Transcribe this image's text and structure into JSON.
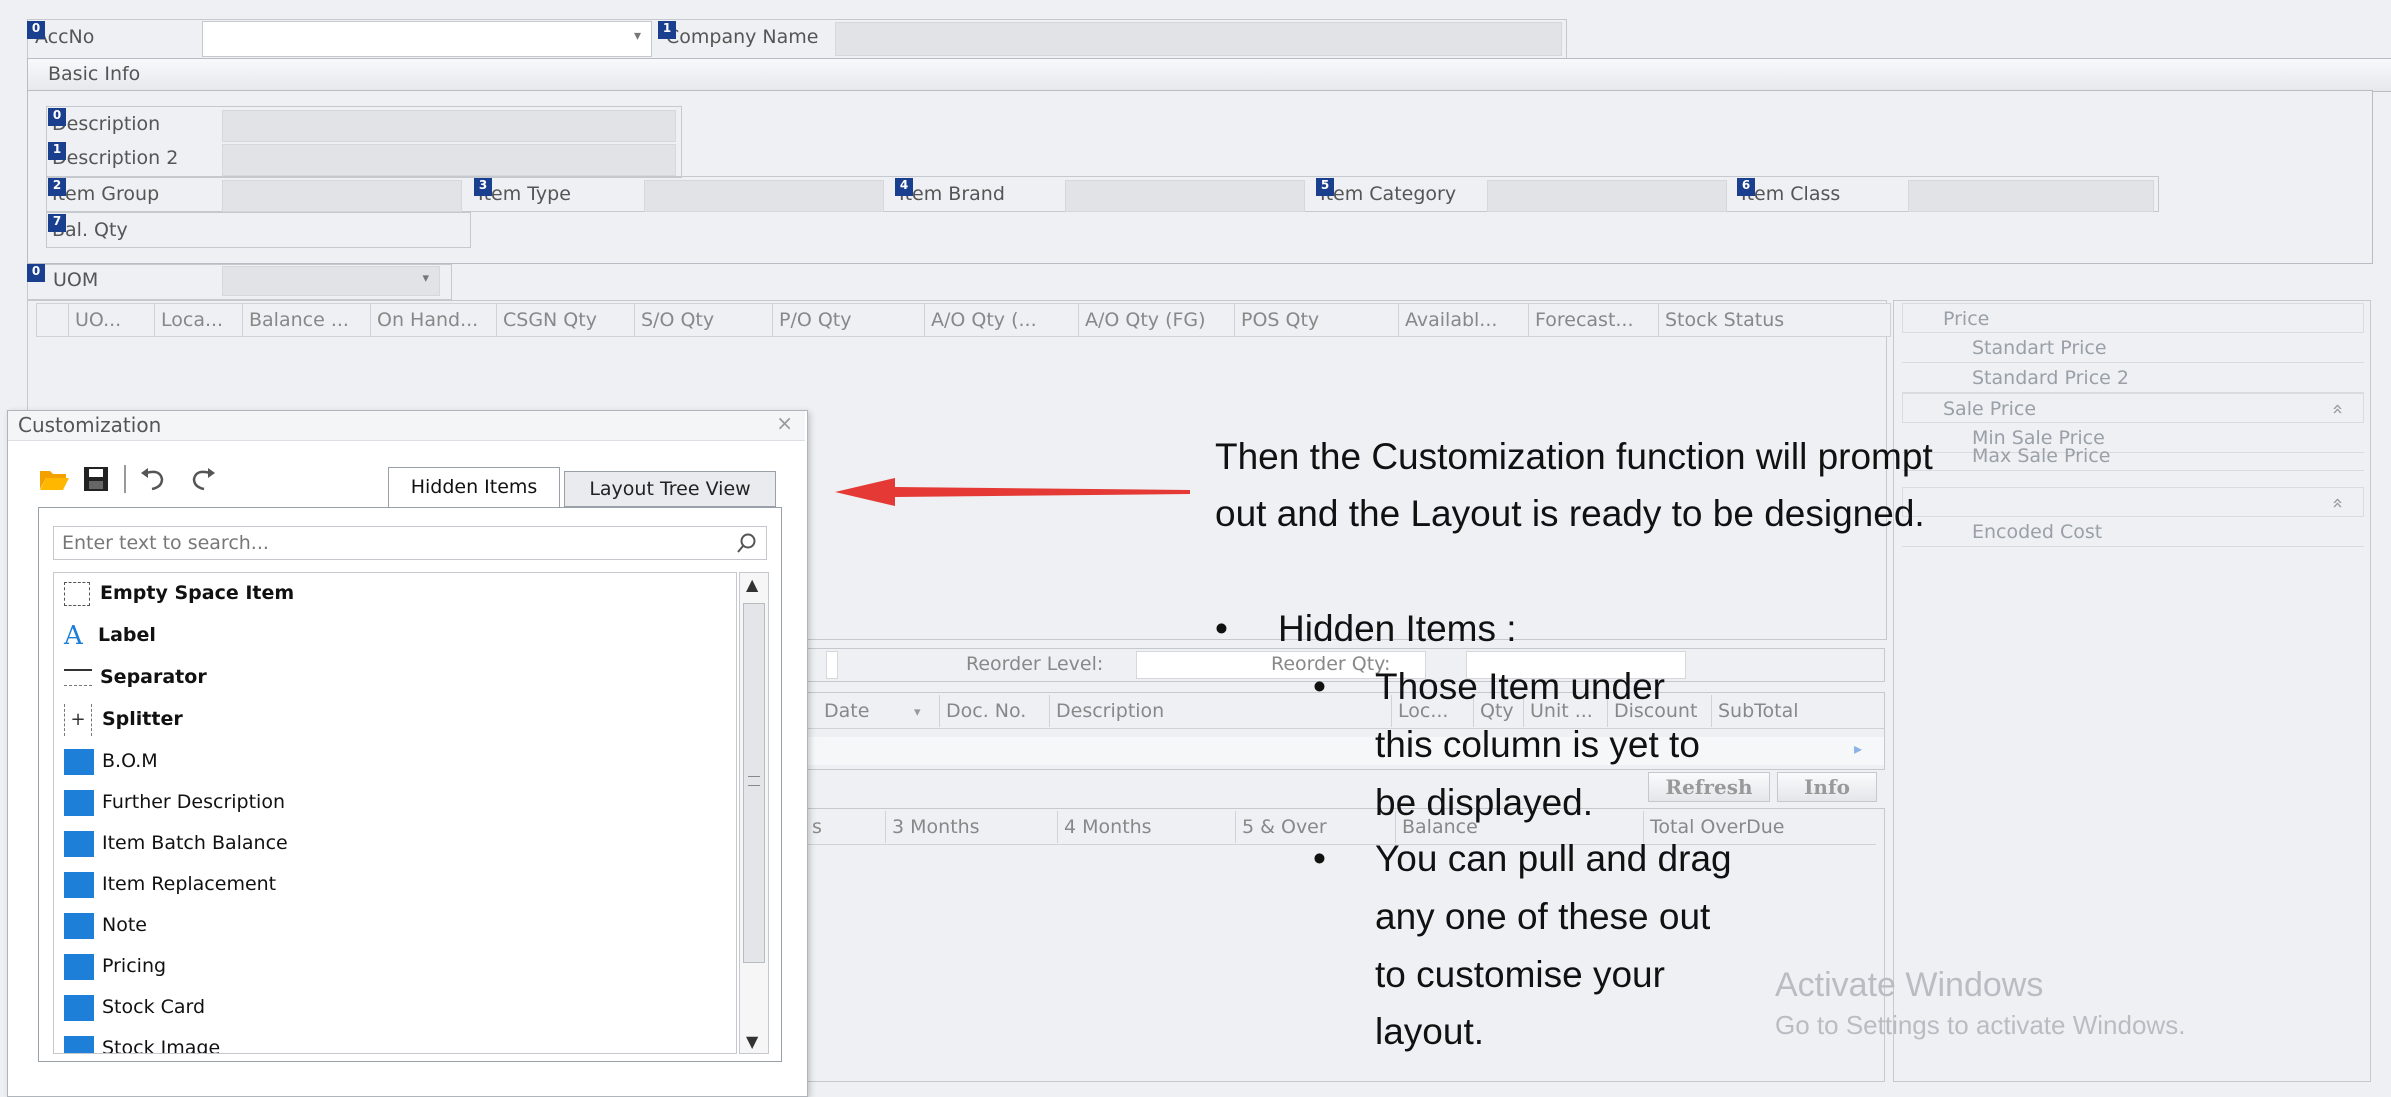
{
  "top": {
    "acc_no_label": "AccNo",
    "acc_no_badge": "0",
    "company_label": "Company Name",
    "company_badge": "1"
  },
  "basic_info": {
    "title": "Basic Info",
    "fields": [
      {
        "badge": "0",
        "label": "Description"
      },
      {
        "badge": "1",
        "label": "Description 2"
      },
      {
        "badge": "2",
        "label": "Item Group"
      },
      {
        "badge": "3",
        "label": "Item Type"
      },
      {
        "badge": "4",
        "label": "Item Brand"
      },
      {
        "badge": "5",
        "label": "Item Category"
      },
      {
        "badge": "6",
        "label": "Item Class"
      },
      {
        "badge": "7",
        "label": "Bal. Qty"
      }
    ]
  },
  "uom": {
    "badge": "0",
    "label": "UOM"
  },
  "balance_grid": {
    "columns": [
      "UO...",
      "Loca...",
      "Balance ...",
      "On Hand...",
      "CSGN Qty",
      "S/O Qty",
      "P/O Qty",
      "A/O Qty (...",
      "A/O Qty (FG)",
      "POS Qty",
      "Availabl...",
      "Forecast...",
      "Stock Status"
    ]
  },
  "price_panel": {
    "rows": [
      "Price",
      "Standart Price",
      "Standard Price 2",
      "Sale Price",
      "Min Sale Price",
      "Max Sale Price",
      "Encoded Cost"
    ],
    "collapse_glyph": "»"
  },
  "reorder": {
    "level_label": "Reorder Level:",
    "qty_label": "Reorder Qty:"
  },
  "transactions_grid": {
    "columns": [
      "Date",
      "Doc. No.",
      "Description",
      "Loc...",
      "Qty",
      "Unit ...",
      "Discount",
      "SubTotal"
    ]
  },
  "buttons": {
    "refresh": "Refresh",
    "info": "Info"
  },
  "aging_grid": {
    "columns": [
      "s",
      "3 Months",
      "4 Months",
      "5 & Over",
      "Balance",
      "Total OverDue"
    ]
  },
  "customization": {
    "title": "Customization",
    "close_glyph": "×",
    "tab_hidden": "Hidden Items",
    "tab_layout": "Layout Tree View",
    "search_placeholder": "Enter text to search...",
    "items": [
      {
        "label": "Empty Space Item",
        "icon": "empty-space-icon",
        "bold": true
      },
      {
        "label": "Label",
        "icon": "label-icon",
        "bold": true
      },
      {
        "label": "Separator",
        "icon": "separator-icon",
        "bold": true
      },
      {
        "label": "Splitter",
        "icon": "splitter-icon",
        "bold": true
      },
      {
        "label": "B.O.M",
        "icon": "group-icon",
        "bold": false
      },
      {
        "label": "Further Description",
        "icon": "group-icon",
        "bold": false
      },
      {
        "label": "Item Batch Balance",
        "icon": "group-icon",
        "bold": false
      },
      {
        "label": "Item Replacement",
        "icon": "group-icon",
        "bold": false
      },
      {
        "label": "Note",
        "icon": "group-icon",
        "bold": false
      },
      {
        "label": "Pricing",
        "icon": "group-icon",
        "bold": false
      },
      {
        "label": "Stock Card",
        "icon": "group-icon",
        "bold": false
      },
      {
        "label": "Stock Image",
        "icon": "group-icon",
        "bold": false
      }
    ]
  },
  "annotation": {
    "line1": "Then the Customization function will prompt",
    "line2": "out and the Layout is ready to be designed.",
    "bullet_head": "Hidden Items :",
    "sub1": [
      "Those Item under",
      "this column is yet to",
      "be displayed."
    ],
    "sub2": [
      "You can pull and drag",
      "any one of these out",
      "to customise your",
      "layout."
    ],
    "bullet": "•"
  },
  "watermark": {
    "line1": "Activate Windows",
    "line2": "Go to Settings to activate Windows."
  },
  "colors": {
    "accent": "#1e7fd8",
    "badge": "#1a3f8f",
    "arrow": "#e53935"
  }
}
